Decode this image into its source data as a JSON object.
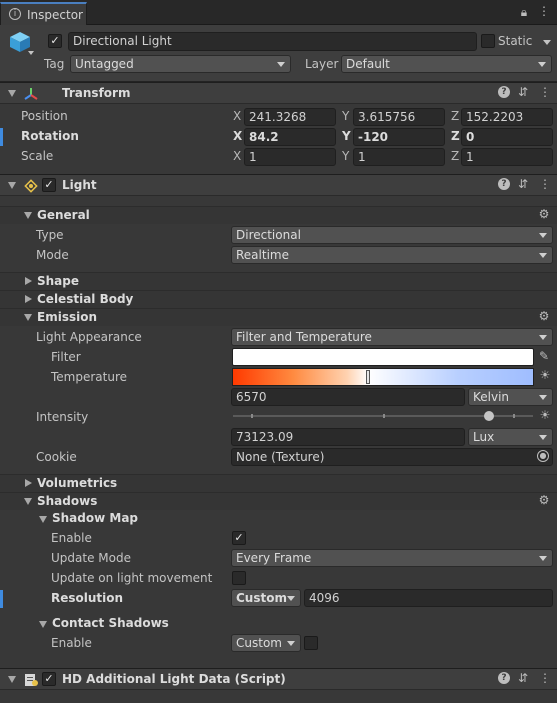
{
  "tab": {
    "label": "Inspector"
  },
  "gameobject": {
    "active": true,
    "name": "Directional Light",
    "static_label": "Static",
    "static_checked": false,
    "tag_label": "Tag",
    "tag_value": "Untagged",
    "layer_label": "Layer",
    "layer_value": "Default"
  },
  "transform": {
    "title": "Transform",
    "position": {
      "label": "Position",
      "x": "241.3268",
      "y": "3.615756",
      "z": "152.2203"
    },
    "rotation": {
      "label": "Rotation",
      "x": "84.2",
      "y": "-120",
      "z": "0"
    },
    "scale": {
      "label": "Scale",
      "x": "1",
      "y": "1",
      "z": "1"
    },
    "axes": {
      "x": "X",
      "y": "Y",
      "z": "Z"
    }
  },
  "light": {
    "title": "Light",
    "general": {
      "title": "General",
      "type_label": "Type",
      "type_value": "Directional",
      "mode_label": "Mode",
      "mode_value": "Realtime"
    },
    "shape": {
      "title": "Shape"
    },
    "celestial": {
      "title": "Celestial Body"
    },
    "emission": {
      "title": "Emission",
      "appearance_label": "Light Appearance",
      "appearance_value": "Filter and Temperature",
      "filter_label": "Filter",
      "filter_color": "#ffffff",
      "temperature_label": "Temperature",
      "temperature_value": "6570",
      "temperature_unit": "Kelvin",
      "temperature_slider": 0.5,
      "intensity_label": "Intensity",
      "intensity_value": "73123.09",
      "intensity_unit": "Lux",
      "intensity_slider": 0.95,
      "cookie_label": "Cookie",
      "cookie_value": "None (Texture)"
    },
    "volumetrics": {
      "title": "Volumetrics"
    },
    "shadows": {
      "title": "Shadows",
      "shadow_map": {
        "title": "Shadow Map",
        "enable_label": "Enable",
        "enable_checked": true,
        "update_mode_label": "Update Mode",
        "update_mode_value": "Every Frame",
        "update_on_move_label": "Update on light movement",
        "update_on_move_checked": false,
        "resolution_label": "Resolution",
        "resolution_mode": "Custom",
        "resolution_value": "4096"
      },
      "contact": {
        "title": "Contact Shadows",
        "enable_label": "Enable",
        "enable_mode": "Custom",
        "enable_checked": false
      }
    }
  },
  "hd_additional": {
    "title": "HD Additional Light Data (Script)"
  },
  "colors": {
    "accent": "#4a7fc0",
    "override_mark": "#3f8be0"
  }
}
